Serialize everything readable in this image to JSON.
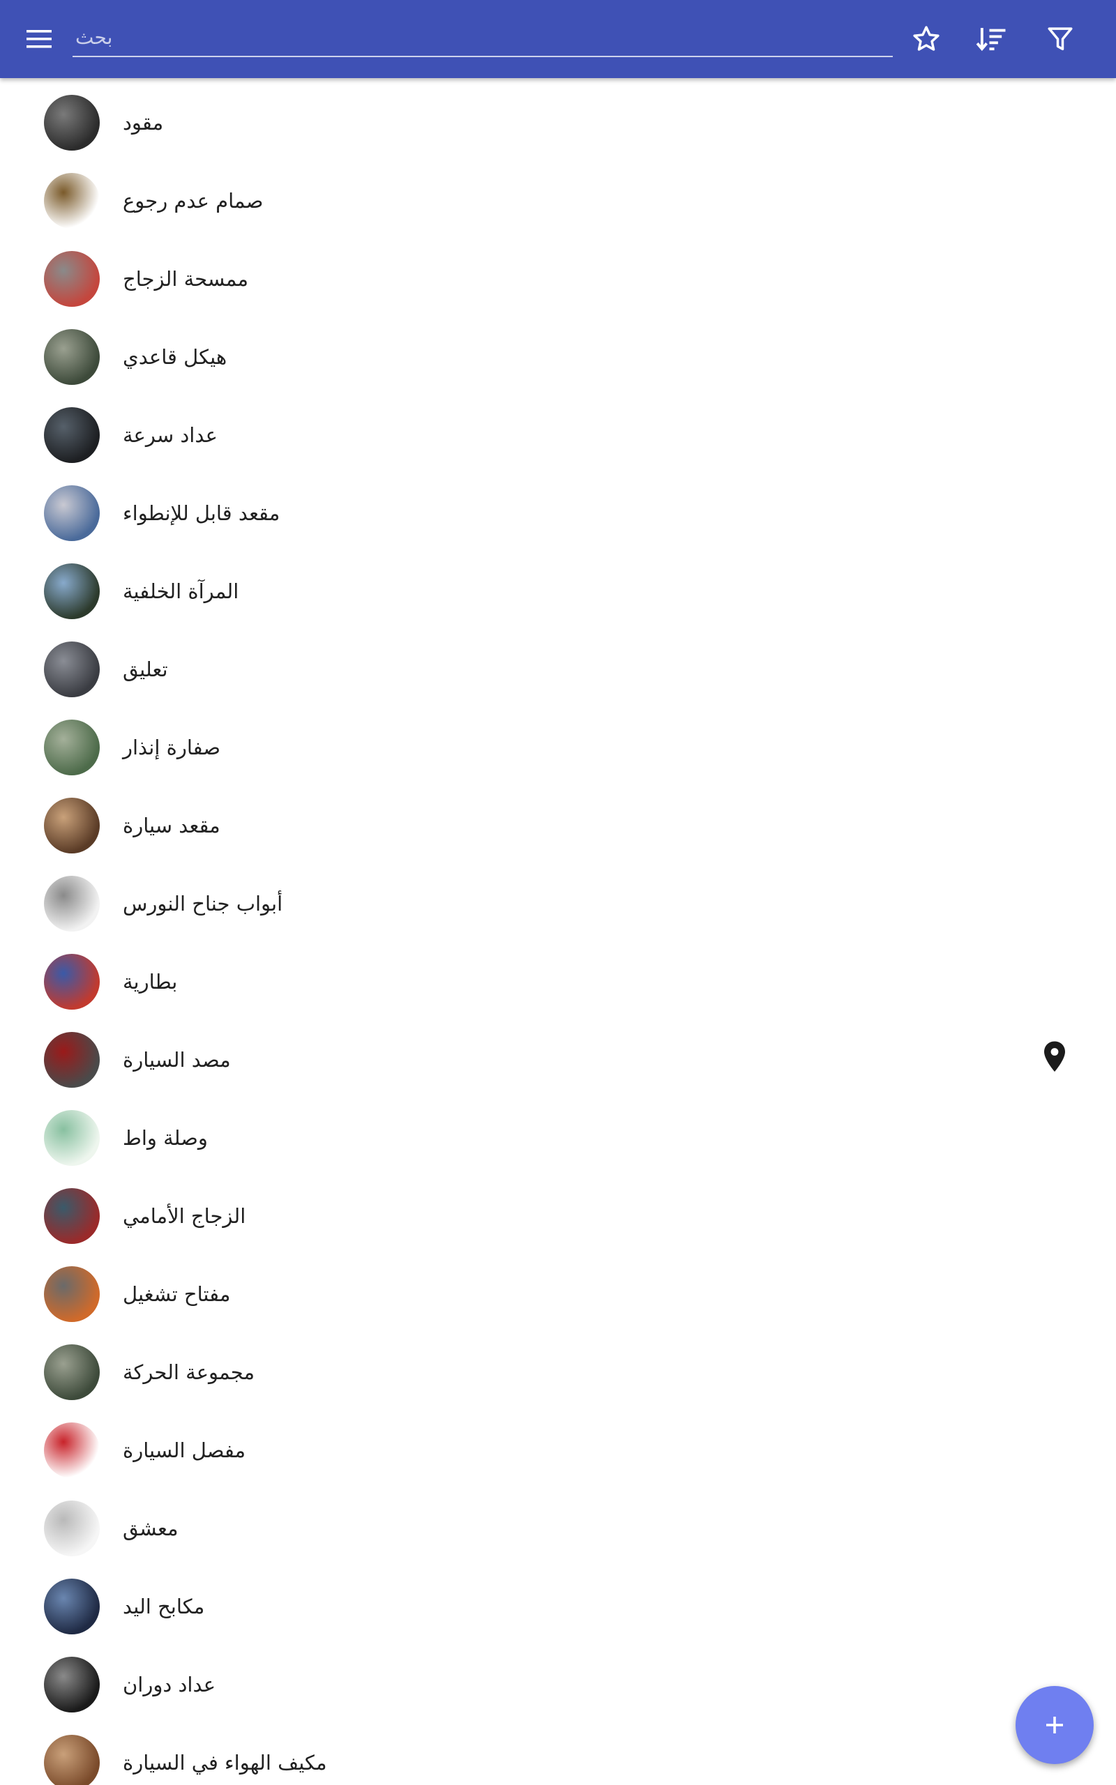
{
  "app_bar": {
    "search_placeholder": "بحث",
    "search_value": "",
    "icons": [
      "menu-icon",
      "star-icon",
      "sort-icon",
      "filter-icon"
    ],
    "color": "#3f51b5"
  },
  "list": {
    "items": [
      {
        "label": "مقود",
        "thumb": "steering-wheel",
        "colors": [
          "#2b2b2b",
          "#7a7a7a"
        ]
      },
      {
        "label": "صمام عدم رجوع",
        "thumb": "check-valve",
        "colors": [
          "#ffffff",
          "#7a5a2a"
        ]
      },
      {
        "label": "ممسحة الزجاج",
        "thumb": "wiper",
        "colors": [
          "#c4463d",
          "#8a8a8a"
        ]
      },
      {
        "label": "هيكل قاعدي",
        "thumb": "chassis",
        "colors": [
          "#3d4a3a",
          "#9aa090"
        ]
      },
      {
        "label": "عداد سرعة",
        "thumb": "speedometer",
        "colors": [
          "#1d1f22",
          "#56606a"
        ]
      },
      {
        "label": "مقعد قابل للإنطواء",
        "thumb": "folding-seat",
        "colors": [
          "#4a6a9a",
          "#c9c9d2"
        ]
      },
      {
        "label": "المرآة الخلفية",
        "thumb": "rearview-mirror",
        "colors": [
          "#2c3a2c",
          "#88aacc"
        ]
      },
      {
        "label": "تعليق",
        "thumb": "suspension",
        "colors": [
          "#3a3c42",
          "#8a8d95"
        ]
      },
      {
        "label": "صفارة إنذار",
        "thumb": "siren",
        "colors": [
          "#4d6b4a",
          "#a4b09a"
        ]
      },
      {
        "label": "مقعد سيارة",
        "thumb": "car-seat",
        "colors": [
          "#5a3b26",
          "#c9a17a"
        ]
      },
      {
        "label": "أبواب جناح النورس",
        "thumb": "gullwing-doors",
        "colors": [
          "#f2f2f2",
          "#8a8a8a"
        ]
      },
      {
        "label": "بطارية",
        "thumb": "battery",
        "colors": [
          "#c23a2e",
          "#3a5aa8"
        ]
      },
      {
        "label": "مصد السيارة",
        "thumb": "bumper",
        "colors": [
          "#4a4a4a",
          "#9a1a1a"
        ],
        "has_location": true
      },
      {
        "label": "وصلة واط",
        "thumb": "watt-linkage",
        "colors": [
          "#eef6ee",
          "#88c0a0"
        ]
      },
      {
        "label": "الزجاج الأمامي",
        "thumb": "windshield",
        "colors": [
          "#9a2a2a",
          "#3a5a6a"
        ]
      },
      {
        "label": "مفتاح تشغيل",
        "thumb": "ignition-switch",
        "colors": [
          "#d06a2a",
          "#6a6a6a"
        ]
      },
      {
        "label": "مجموعة الحركة",
        "thumb": "powertrain",
        "colors": [
          "#3d4a3a",
          "#9aa090"
        ]
      },
      {
        "label": "مفصل السيارة",
        "thumb": "car-joint",
        "colors": [
          "#ffffff",
          "#c8232a"
        ]
      },
      {
        "label": "معشق",
        "thumb": "clutch",
        "colors": [
          "#f6f6f6",
          "#b9b9b9"
        ]
      },
      {
        "label": "مكابح اليد",
        "thumb": "handbrake",
        "colors": [
          "#1f2a44",
          "#6a86b0"
        ]
      },
      {
        "label": "عداد دوران",
        "thumb": "tachometer",
        "colors": [
          "#1a1a1a",
          "#8a8a8a"
        ]
      },
      {
        "label": "مكيف الهواء في السيارة",
        "thumb": "car-ac",
        "colors": [
          "#7a4a2a",
          "#c9a07a"
        ]
      }
    ]
  },
  "fab": {
    "icon": "plus-icon",
    "color": "#6f7ff0"
  }
}
